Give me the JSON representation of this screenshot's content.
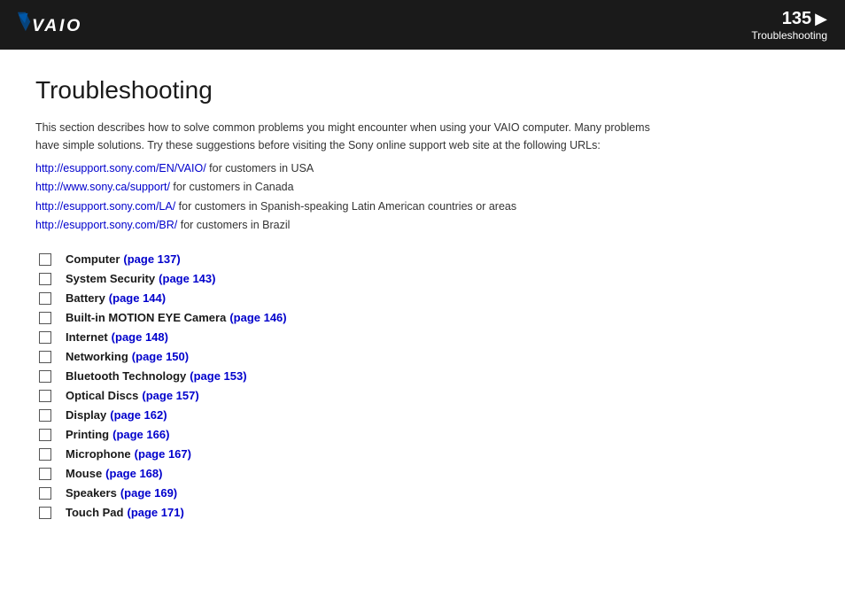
{
  "header": {
    "page_number": "135",
    "arrow": "▶",
    "section": "Troubleshooting"
  },
  "page_title": "Troubleshooting",
  "intro": {
    "line1": "This section describes how to solve common problems you might encounter when using your VAIO computer. Many problems",
    "line2": "have simple solutions. Try these suggestions before visiting the Sony online support web site at the following URLs:"
  },
  "urls": [
    {
      "url": "http://esupport.sony.com/EN/VAIO/",
      "suffix": " for customers in USA"
    },
    {
      "url": "http://www.sony.ca/support/",
      "suffix": " for customers in Canada"
    },
    {
      "url": "http://esupport.sony.com/LA/",
      "suffix": " for customers in Spanish-speaking Latin American countries or areas"
    },
    {
      "url": "http://esupport.sony.com/BR/",
      "suffix": " for customers in Brazil"
    }
  ],
  "toc": [
    {
      "label": "Computer",
      "link": "(page 137)"
    },
    {
      "label": "System Security",
      "link": "(page 143)"
    },
    {
      "label": "Battery",
      "link": "(page 144)"
    },
    {
      "label": "Built-in MOTION EYE Camera",
      "link": "(page 146)"
    },
    {
      "label": "Internet",
      "link": "(page 148)"
    },
    {
      "label": "Networking",
      "link": "(page 150)"
    },
    {
      "label": "Bluetooth Technology",
      "link": "(page 153)"
    },
    {
      "label": "Optical Discs",
      "link": "(page 157)"
    },
    {
      "label": "Display",
      "link": "(page 162)"
    },
    {
      "label": "Printing",
      "link": "(page 166)"
    },
    {
      "label": "Microphone",
      "link": "(page 167)"
    },
    {
      "label": "Mouse",
      "link": "(page 168)"
    },
    {
      "label": "Speakers",
      "link": "(page 169)"
    },
    {
      "label": "Touch Pad",
      "link": "(page 171)"
    }
  ]
}
